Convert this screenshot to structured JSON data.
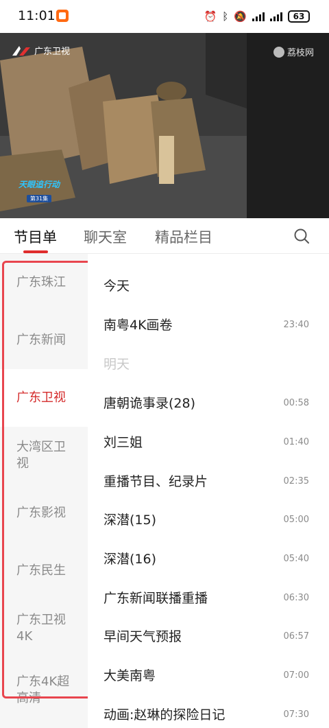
{
  "status_bar": {
    "time": "11:01",
    "battery": "63"
  },
  "video": {
    "channel_logo_text": "广东卫视",
    "watermark_text": "荔枝网",
    "show_title": "天眼追行动",
    "episode": "第31集"
  },
  "tabs": [
    {
      "label": "节目单"
    },
    {
      "label": "聊天室"
    },
    {
      "label": "精品栏目"
    }
  ],
  "channels": [
    {
      "label": "广东珠江"
    },
    {
      "label": "广东新闻"
    },
    {
      "label": "广东卫视"
    },
    {
      "label": "大湾区卫视"
    },
    {
      "label": "广东影视"
    },
    {
      "label": "广东民生"
    },
    {
      "label": "广东卫视4K"
    },
    {
      "label": "广东4K超高清"
    }
  ],
  "selected_channel": "广东卫视",
  "schedule": [
    {
      "name": "今天",
      "time": ""
    },
    {
      "name": "南粤4K画卷",
      "time": "23:40"
    },
    {
      "name": "明天",
      "time": ""
    },
    {
      "name": "唐朝诡事录(28)",
      "time": "00:58"
    },
    {
      "name": "刘三姐",
      "time": "01:40"
    },
    {
      "name": "重播节目、纪录片",
      "time": "02:35"
    },
    {
      "name": "深潜(15)",
      "time": "05:00"
    },
    {
      "name": "深潜(16)",
      "time": "05:40"
    },
    {
      "name": "广东新闻联播重播",
      "time": "06:30"
    },
    {
      "name": "早间天气预报",
      "time": "06:57"
    },
    {
      "name": "大美南粤",
      "time": "07:00"
    },
    {
      "name": "动画:赵琳的探险日记",
      "time": "07:30"
    }
  ],
  "colors": {
    "accent": "#e02c2c",
    "selected_channel_text": "#d42b2b",
    "annotation_box": "#e8454e"
  }
}
